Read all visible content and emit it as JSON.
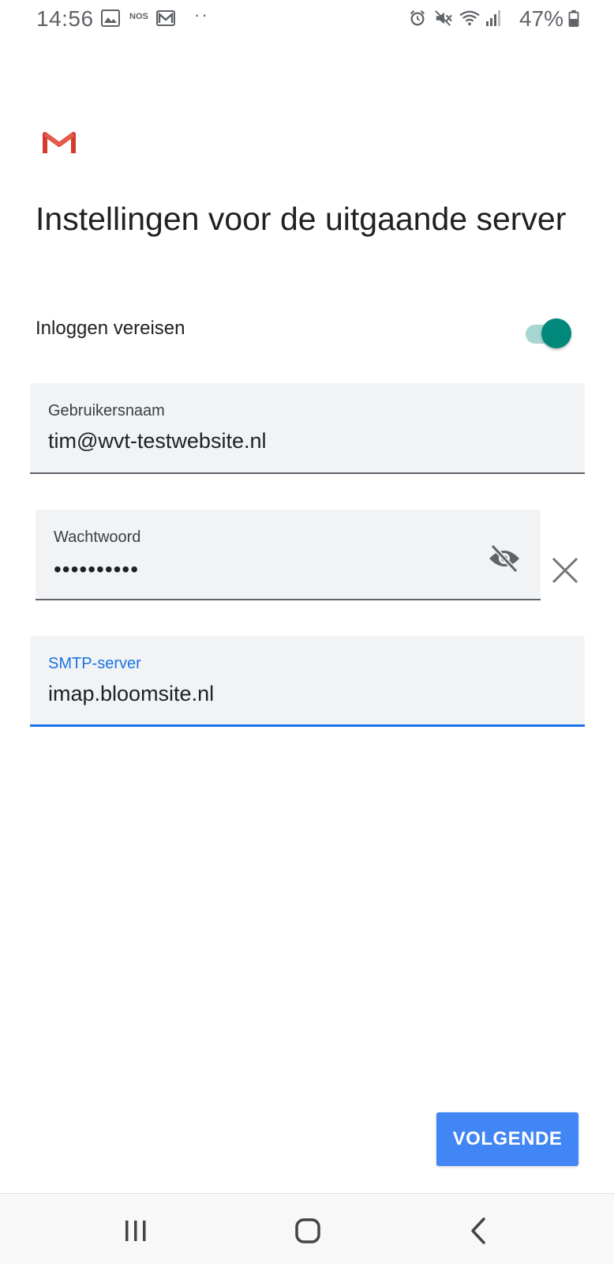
{
  "status_bar": {
    "time": "14:56",
    "notification_text": "NOS",
    "battery": "47%",
    "icons": [
      "image-icon",
      "nos-icon",
      "gmail-icon",
      "more-dots-icon",
      "alarm-icon",
      "mute-icon",
      "wifi-icon",
      "signal-icon",
      "battery-icon"
    ]
  },
  "header": {
    "logo": "gmail-logo",
    "title": "Instellingen voor de uitgaande server"
  },
  "login_toggle": {
    "label": "Inloggen vereisen",
    "on": true,
    "color": "#00897b"
  },
  "fields": {
    "username": {
      "label": "Gebruikersnaam",
      "value": "tim@wvt-testwebsite.nl"
    },
    "password": {
      "label": "Wachtwoord",
      "masked_value": "••••••••••"
    },
    "smtp": {
      "label": "SMTP-server",
      "value": "imap.bloomsite.nl",
      "focused": true,
      "accent": "#1a73e8"
    }
  },
  "actions": {
    "next_label": "VOLGENDE",
    "next_color": "#4285f4"
  },
  "nav_bar": {
    "icons": [
      "recents-icon",
      "home-icon",
      "back-icon"
    ]
  }
}
